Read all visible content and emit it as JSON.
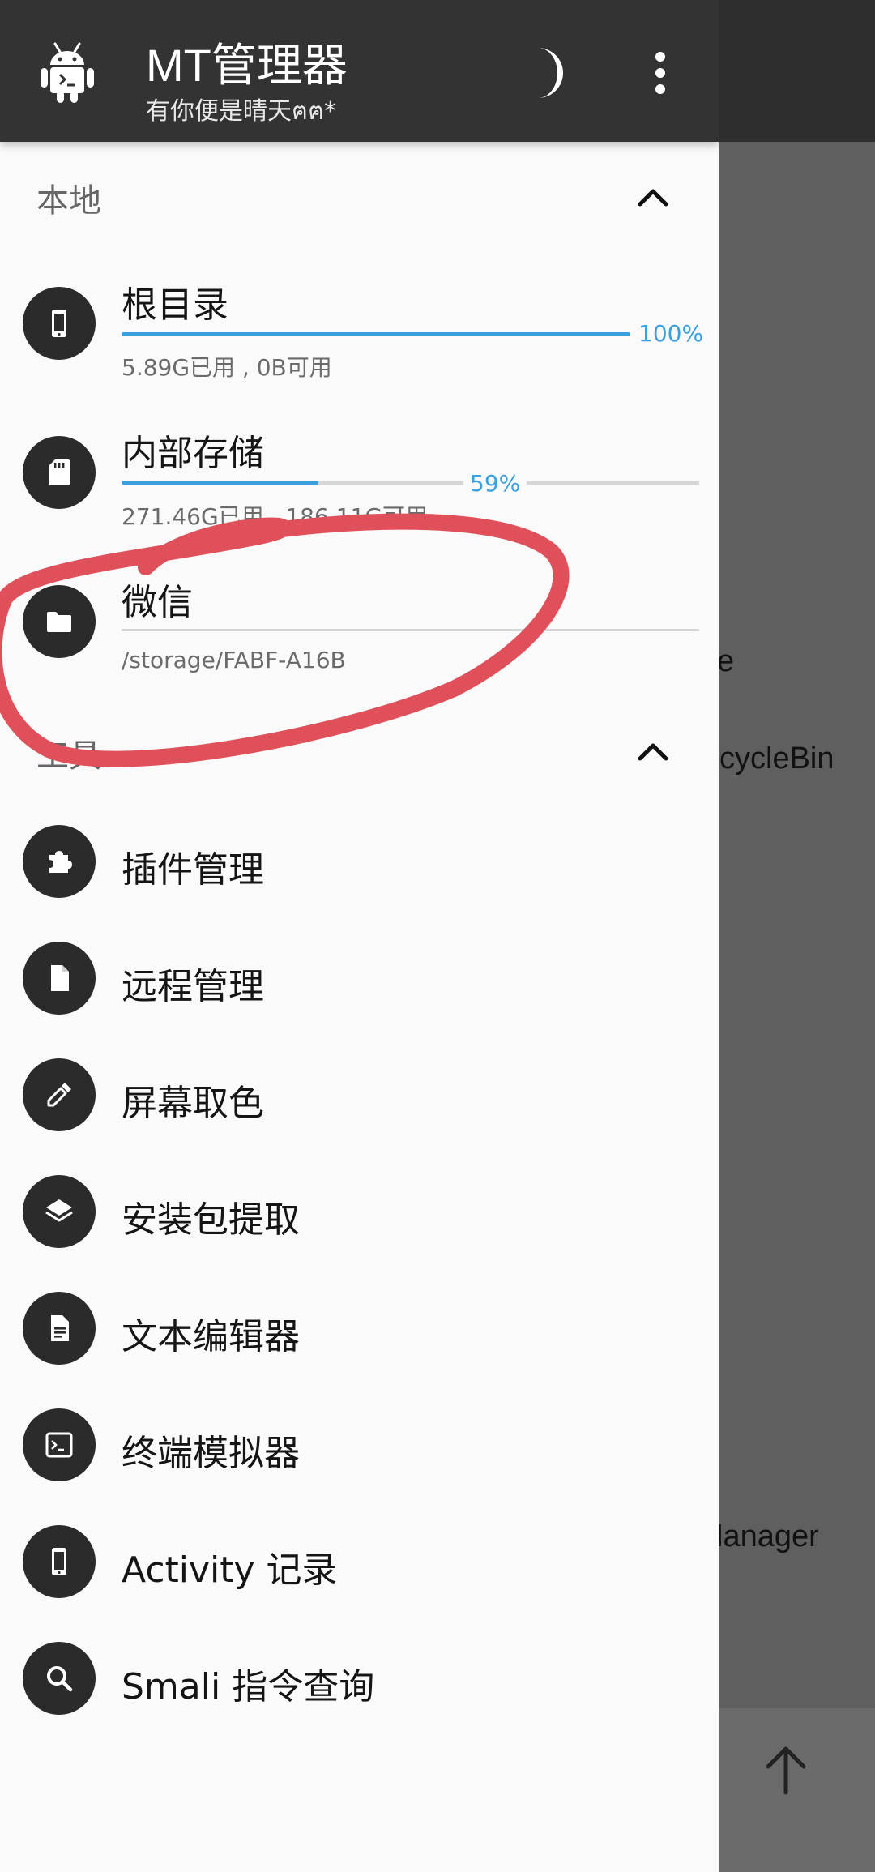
{
  "background": {
    "peek_texts": [
      "e",
      "cycleBin",
      "lanager"
    ]
  },
  "header": {
    "title": "MT管理器",
    "subtitle": "有你便是晴天ฅฅ*"
  },
  "local": {
    "section_title": "本地",
    "items": [
      {
        "label": "根目录",
        "sub": "5.89G已用 , 0B可用",
        "percent_text": "100%",
        "percent": 100,
        "icon": "phone-icon"
      },
      {
        "label": "内部存储",
        "sub": "271.46G已用 , 186.11G可用",
        "percent_text": "59%",
        "percent": 59,
        "icon": "sd-card-icon"
      },
      {
        "label": "微信",
        "sub": "/storage/FABF-A16B",
        "icon": "folder-icon"
      }
    ]
  },
  "tools": {
    "section_title": "工具",
    "items": [
      {
        "label": "插件管理",
        "icon": "puzzle-icon"
      },
      {
        "label": "远程管理",
        "icon": "document-icon"
      },
      {
        "label": "屏幕取色",
        "icon": "eyedropper-icon"
      },
      {
        "label": "安装包提取",
        "icon": "layers-icon"
      },
      {
        "label": "文本编辑器",
        "icon": "text-document-icon"
      },
      {
        "label": "终端模拟器",
        "icon": "terminal-icon"
      },
      {
        "label": "Activity 记录",
        "icon": "phone-icon"
      },
      {
        "label": "Smali 指令查询",
        "icon": "search-icon"
      }
    ]
  },
  "colors": {
    "header_bg": "#333333",
    "accent_blue": "#3aa0e0",
    "annotation_red": "#e0505a",
    "icon_circle": "#2b2b2b"
  }
}
